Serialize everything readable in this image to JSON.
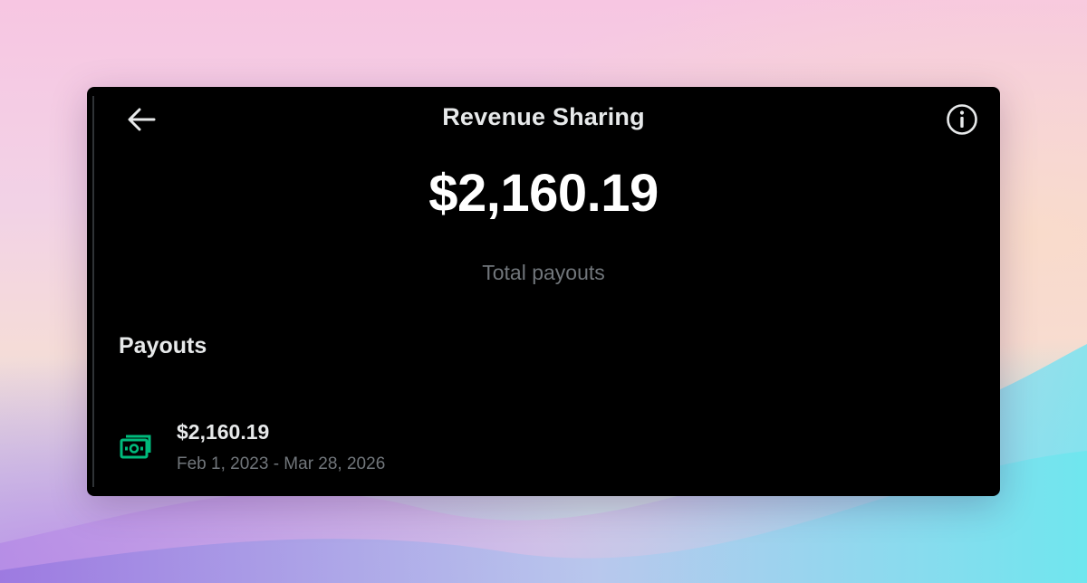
{
  "header": {
    "title": "Revenue Sharing",
    "back_icon": "arrow-left-icon",
    "info_icon": "info-circle-icon"
  },
  "summary": {
    "total_amount": "$2,160.19",
    "total_label": "Total payouts"
  },
  "payouts": {
    "heading": "Payouts",
    "items": [
      {
        "amount": "$2,160.19",
        "period": "Feb 1, 2023 - Mar 28, 2026",
        "icon": "money-bill-icon"
      }
    ]
  },
  "colors": {
    "panel_bg": "#000000",
    "primary_text": "#e7e9ea",
    "secondary_text": "#71767b",
    "money_icon": "#00ba7c"
  }
}
